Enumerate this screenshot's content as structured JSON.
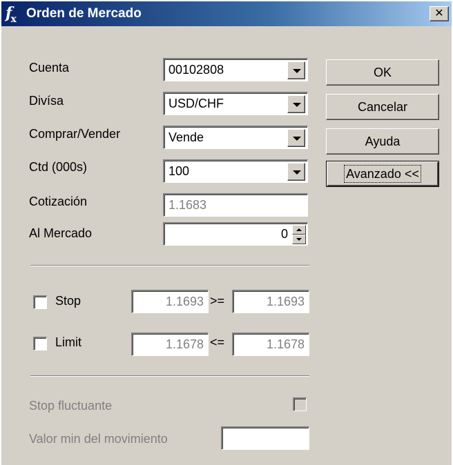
{
  "window": {
    "title": "Orden de Mercado",
    "icon": "fx-icon",
    "close_label": "✕"
  },
  "form": {
    "cuenta": {
      "label": "Cuenta",
      "value": "00102808"
    },
    "divisa": {
      "label": "Divísa",
      "value": "USD/CHF"
    },
    "comprar_vender": {
      "label": "Comprar/Vender",
      "value": "Vende"
    },
    "ctd": {
      "label": "Ctd (000s)",
      "value": "100"
    },
    "cotizacion": {
      "label": "Cotización",
      "value": "1.1683"
    },
    "al_mercado": {
      "label": "Al Mercado",
      "value": "0"
    }
  },
  "buttons": {
    "ok": "OK",
    "cancelar": "Cancelar",
    "ayuda": "Ayuda",
    "avanzado": "Avanzado <<"
  },
  "stop": {
    "label": "Stop",
    "checked": false,
    "left_value": "1.1693",
    "operator": ">=",
    "right_value": "1.1693"
  },
  "limit": {
    "label": "Limit",
    "checked": false,
    "left_value": "1.1678",
    "operator": "<=",
    "right_value": "1.1678"
  },
  "trailing": {
    "stop_fluctuante_label": "Stop fluctuante",
    "valor_min_label": "Valor min del movimiento",
    "valor_min_value": ""
  },
  "colors": {
    "dialog_face": "#d4d0c8",
    "title_start": "#0a246a",
    "title_end": "#a6caf0",
    "disabled_text": "#808080"
  }
}
